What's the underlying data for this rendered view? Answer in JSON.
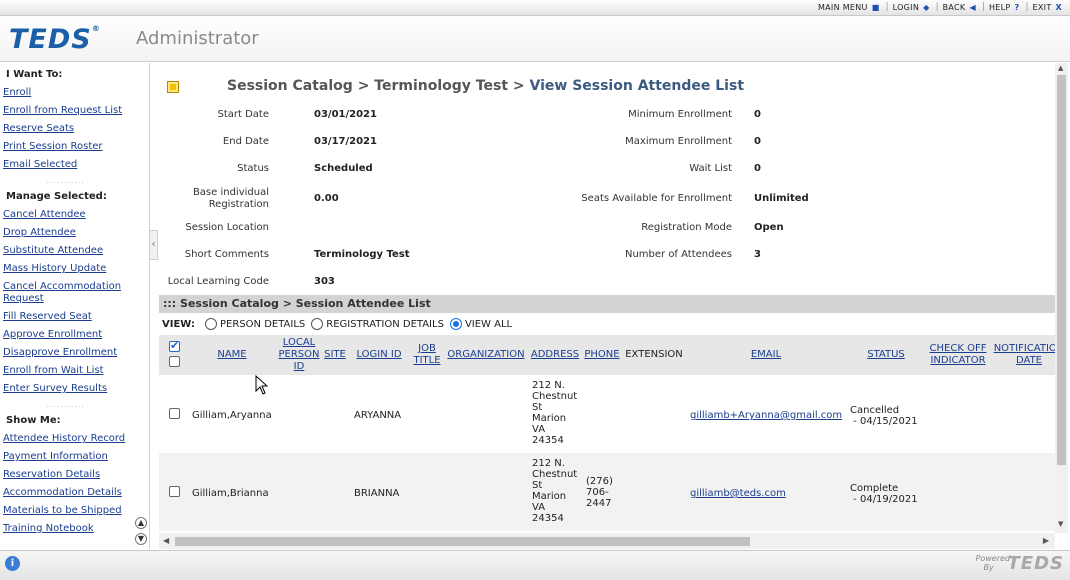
{
  "topnav": {
    "items": [
      {
        "label": "MAIN MENU",
        "icon": "■"
      },
      {
        "label": "LOGIN",
        "icon": "◆"
      },
      {
        "label": "BACK",
        "icon": "◀"
      },
      {
        "label": "HELP",
        "icon": "?"
      },
      {
        "label": "EXIT",
        "icon": "X"
      }
    ]
  },
  "header": {
    "logo": "TEDS",
    "logo_mark": "®",
    "app_name": "Administrator"
  },
  "sidebar": {
    "i_want_to": "I Want To:",
    "i_want_to_items": [
      "Enroll",
      "Enroll from Request List",
      "Reserve Seats",
      "Print Session Roster",
      "Email Selected"
    ],
    "manage_selected": "Manage Selected:",
    "manage_items": [
      "Cancel Attendee",
      "Drop Attendee",
      "Substitute Attendee",
      "Mass History Update",
      "Cancel Accommodation Request",
      "Fill Reserved Seat",
      "Approve Enrollment",
      "Disapprove Enrollment",
      "Enroll from Wait List",
      "Enter Survey Results"
    ],
    "show_me": "Show Me:",
    "show_items": [
      "Attendee History Record",
      "Payment Information",
      "Reservation Details",
      "Accommodation Details",
      "Materials to be Shipped",
      "Training Notebook"
    ]
  },
  "breadcrumb": {
    "part1": "Session Catalog",
    "sep": ">",
    "part2": "Terminology Test",
    "current": "View Session Attendee List"
  },
  "details": {
    "start_date_label": "Start Date",
    "start_date": "03/01/2021",
    "end_date_label": "End Date",
    "end_date": "03/17/2021",
    "status_label": "Status",
    "status": "Scheduled",
    "base_reg_label": "Base individual Registration",
    "base_reg": "0.00",
    "location_label": "Session Location",
    "location": "",
    "short_comments_label": "Short Comments",
    "short_comments": "Terminology Test",
    "llc_label": "Local Learning Code",
    "llc": "303",
    "min_enroll_label": "Minimum Enrollment",
    "min_enroll": "0",
    "max_enroll_label": "Maximum Enrollment",
    "max_enroll": "0",
    "wait_list_label": "Wait List",
    "wait_list": "0",
    "seats_label": "Seats Available for Enrollment",
    "seats": "Unlimited",
    "reg_mode_label": "Registration Mode",
    "reg_mode": "Open",
    "num_attendees_label": "Number of Attendees",
    "num_attendees": "3"
  },
  "section_title": "::: Session Catalog > Session Attendee List",
  "view": {
    "label": "VIEW:",
    "options": [
      "PERSON DETAILS",
      "REGISTRATION DETAILS",
      "VIEW ALL"
    ],
    "selected": "VIEW ALL"
  },
  "columns": {
    "name": "NAME",
    "local_person_id": "LOCAL PERSON ID",
    "site": "SITE",
    "login_id": "LOGIN ID",
    "job_title": "JOB TITLE",
    "organization": "ORGANIZATION",
    "address": "ADDRESS",
    "phone": "PHONE",
    "extension": "EXTENSION",
    "email": "EMAIL",
    "status": "STATUS",
    "check_off": "CHECK OFF INDICATOR",
    "notification": "NOTIFICATION DATE"
  },
  "rows": [
    {
      "name": "Gilliam,Aryanna",
      "login": "ARYANNA",
      "address": [
        "212 N.",
        "Chestnut",
        "St",
        "Marion",
        "VA",
        "24354"
      ],
      "phone": [],
      "email": "gilliamb+Aryanna@gmail.com",
      "status": "Cancelled",
      "status_date": " - 04/15/2021"
    },
    {
      "name": "Gilliam,Brianna",
      "login": "BRIANNA",
      "address": [
        "212 N.",
        "Chestnut",
        "St",
        "Marion",
        "VA",
        "24354"
      ],
      "phone": [
        "(276)",
        "706-",
        "2447"
      ],
      "email": "gilliamb@teds.com",
      "status": "Complete",
      "status_date": " - 04/19/2021"
    }
  ],
  "footer": {
    "powered": "Powered",
    "by": "By",
    "logo": "TEDS"
  }
}
